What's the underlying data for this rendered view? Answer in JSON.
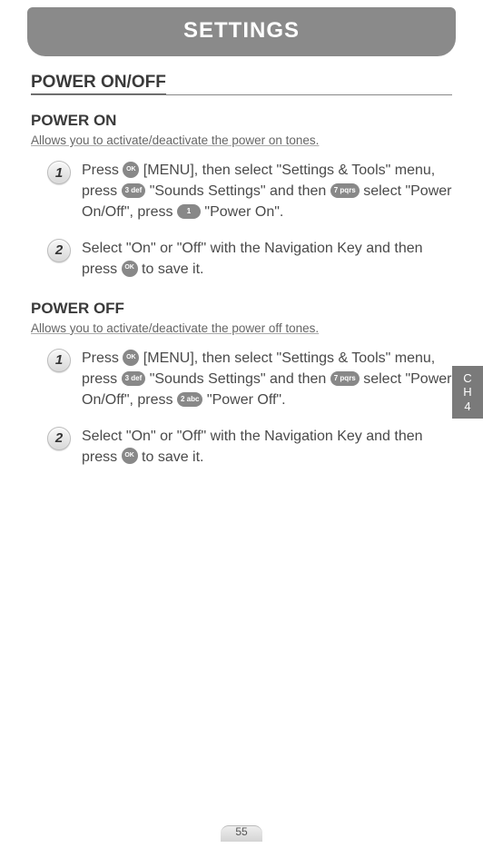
{
  "header": {
    "title": "SETTINGS"
  },
  "section_title": "POWER ON/OFF",
  "power_on": {
    "title": "POWER ON",
    "desc": "Allows you to activate/deactivate the power on tones.",
    "steps": [
      {
        "n": "1",
        "pre1": "Press ",
        "ok1": "OK",
        "mid1": " [MENU], then select \"Settings & Tools\" menu, press ",
        "key1": "3 def",
        "mid2": " \"Sounds Settings\" and then ",
        "key2": "7 pqrs",
        "mid3": " select \"Power On/Off\", press ",
        "key3": "1",
        "tail": "  \"Power On\"."
      },
      {
        "n": "2",
        "pre1": "Select \"On\" or \"Off\" with the Navigation Key and then press ",
        "ok1": "OK",
        "tail": "  to save it."
      }
    ]
  },
  "power_off": {
    "title": "POWER OFF",
    "desc": "Allows you to activate/deactivate the power off tones.",
    "steps": [
      {
        "n": "1",
        "pre1": "Press ",
        "ok1": "OK",
        "mid1": " [MENU], then select \"Settings & Tools\" menu, press ",
        "key1": "3 def",
        "mid2": " \"Sounds Settings\" and then ",
        "key2": "7 pqrs",
        "mid3": " select \"Power On/Off\", press ",
        "key3": "2 abc",
        "tail": " \"Power Off\"."
      },
      {
        "n": "2",
        "pre1": "Select \"On\" or \"Off\" with the Navigation Key and then press ",
        "ok1": "OK",
        "tail": "  to save it."
      }
    ]
  },
  "side_tab": {
    "line1": "C",
    "line2": "H",
    "line3": "4"
  },
  "page_number": "55"
}
